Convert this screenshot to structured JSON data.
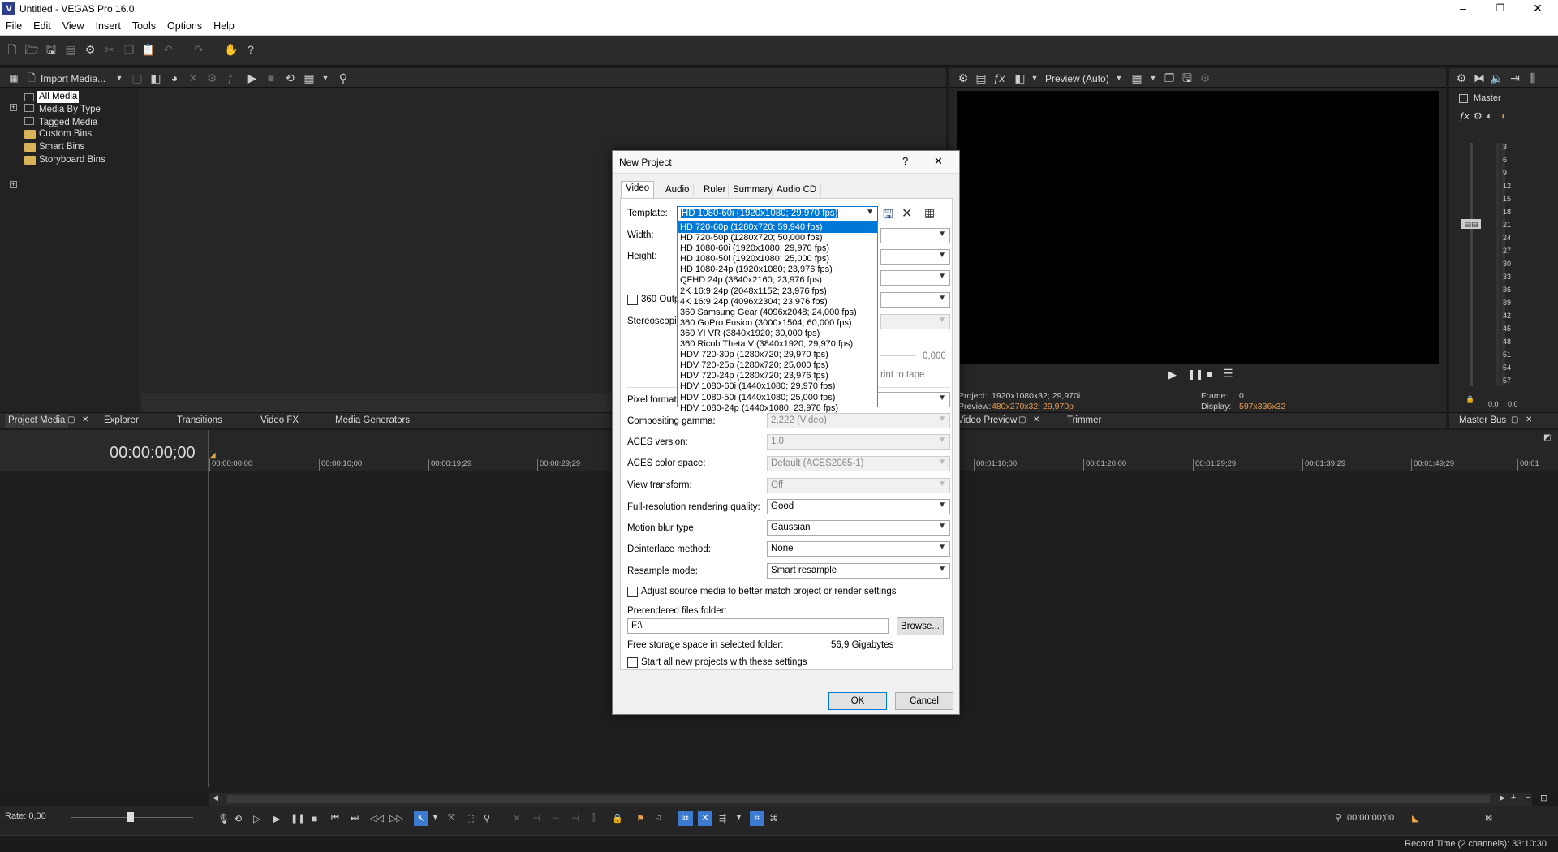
{
  "app": {
    "title": "Untitled - VEGAS Pro 16.0",
    "icon_letter": "V",
    "window_controls": [
      "–",
      "❐",
      "✕"
    ]
  },
  "menu": [
    "File",
    "Edit",
    "View",
    "Insert",
    "Tools",
    "Options",
    "Help"
  ],
  "media_panel": {
    "import_label": "Import Media...",
    "tree": [
      "All Media",
      "Media By Type",
      "Tagged Media",
      "Custom Bins",
      "Smart Bins",
      "Storyboard Bins"
    ],
    "tree_expanders": [
      "+",
      "+"
    ]
  },
  "preview": {
    "mode_label": "Preview (Auto)",
    "project_label": "Project:",
    "project_value": "1920x1080x32; 29,970i",
    "preview_label": "Preview:",
    "preview_value": "480x270x32; 29,970p",
    "frame_label": "Frame:",
    "frame_value": "0",
    "display_label": "Display:",
    "display_value": "597x336x32"
  },
  "master": {
    "label": "Master",
    "meter_scale": [
      "3",
      "6",
      "9",
      "12",
      "15",
      "18",
      "21",
      "24",
      "27",
      "30",
      "33",
      "36",
      "39",
      "42",
      "45",
      "48",
      "51",
      "54",
      "57"
    ],
    "left_level": "0.0",
    "right_level": "0.0"
  },
  "bottom_tabs": {
    "left": [
      "Project Media",
      "Explorer",
      "Transitions",
      "Video FX",
      "Media Generators"
    ],
    "middle": [
      "Video Preview",
      "Trimmer"
    ],
    "right": [
      "Master Bus"
    ]
  },
  "timeline": {
    "timecode": "00:00:00;00",
    "ruler": [
      "00:00:00;00",
      "00:00:10;00",
      "00:00:19;29",
      "00:00:29;29",
      "00:01:10;00",
      "00:01:20;00",
      "00:01:29;29",
      "00:01:39;29",
      "00:01:49;29",
      "00:01"
    ],
    "rate_label": "Rate: 0,00",
    "transport_time": "00:00:00;00",
    "record_time": "Record Time (2 channels): 33:10:30"
  },
  "dialog": {
    "title": "New Project",
    "help": "?",
    "close": "✕",
    "tabs": [
      "Video",
      "Audio",
      "Ruler",
      "Summary",
      "Audio CD"
    ],
    "template_label": "Template:",
    "template_value": "HD 1080-60i (1920x1080; 29,970 fps)",
    "template_options": [
      "HD 720-60p (1280x720; 59,940 fps)",
      "HD 720-50p (1280x720; 50,000 fps)",
      "HD 1080-60i (1920x1080; 29,970 fps)",
      "HD 1080-50i (1920x1080; 25,000 fps)",
      "HD 1080-24p (1920x1080; 23,976 fps)",
      "QFHD 24p (3840x2160; 23,976 fps)",
      "2K 16:9 24p (2048x1152; 23,976 fps)",
      "4K 16:9 24p (4096x2304; 23,976 fps)",
      "360 Samsung Gear (4096x2048; 24,000 fps)",
      "360 GoPro Fusion (3000x1504; 60,000 fps)",
      "360 YI VR (3840x1920; 30,000 fps)",
      "360 Ricoh Theta V (3840x1920; 29,970 fps)",
      "HDV 720-30p (1280x720; 29,970 fps)",
      "HDV 720-25p (1280x720; 25,000 fps)",
      "HDV 720-24p (1280x720; 23,976 fps)",
      "HDV 1080-60i (1440x1080; 29,970 fps)",
      "HDV 1080-50i (1440x1080; 25,000 fps)",
      "HDV 1080-24p (1440x1080; 23,976 fps)"
    ],
    "width_label": "Width:",
    "height_label": "Height:",
    "output_360_label": "360 Outp",
    "stereoscopic_label": "Stereoscopic",
    "slider_value": "0,000",
    "print_to_tape": "rint to tape",
    "pixel_format_label": "Pixel format:",
    "compositing_gamma_label": "Compositing gamma:",
    "compositing_gamma_value": "2,222 (Video)",
    "aces_version_label": "ACES version:",
    "aces_version_value": "1.0",
    "aces_color_space_label": "ACES color space:",
    "aces_color_space_value": "Default (ACES2065-1)",
    "view_transform_label": "View transform:",
    "view_transform_value": "Off",
    "rendering_quality_label": "Full-resolution rendering quality:",
    "rendering_quality_value": "Good",
    "motion_blur_label": "Motion blur type:",
    "motion_blur_value": "Gaussian",
    "deinterlace_label": "Deinterlace method:",
    "deinterlace_value": "None",
    "resample_label": "Resample mode:",
    "resample_value": "Smart resample",
    "adjust_source_label": "Adjust source media to better match project or render settings",
    "prerendered_label": "Prerendered files folder:",
    "prerendered_value": "F:\\",
    "browse_label": "Browse...",
    "free_space_label": "Free storage space in selected folder:",
    "free_space_value": "56,9 Gigabytes",
    "start_all_label": "Start all new projects with these settings",
    "ok_label": "OK",
    "cancel_label": "Cancel"
  }
}
